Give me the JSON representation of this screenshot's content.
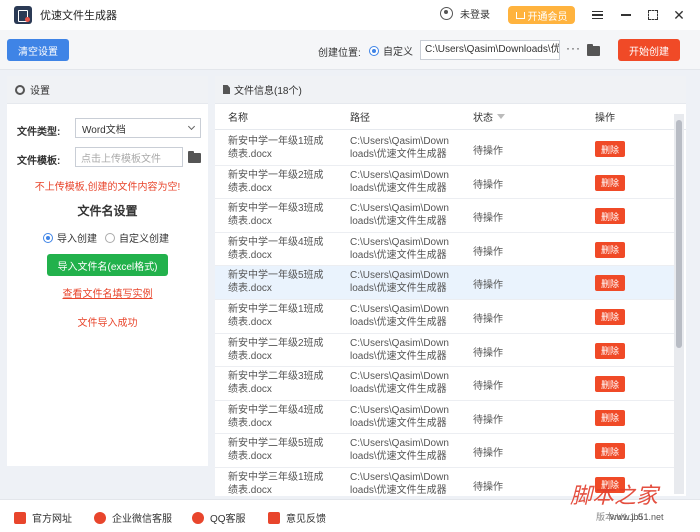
{
  "app": {
    "title": "优速文件生成器"
  },
  "header": {
    "login": "未登录",
    "vip": "开通会员"
  },
  "toolbar": {
    "clear_label": "清空设置",
    "location_label": "创建位置:",
    "location_mode": "自定义",
    "path_value": "C:\\Users\\Qasim\\Downloads\\优",
    "more": "···",
    "start_label": "开始创建"
  },
  "settings": {
    "title": "设置",
    "file_type_label": "文件类型:",
    "file_type_value": "Word文档",
    "template_label": "文件模板:",
    "template_placeholder": "点击上传模板文件",
    "warning": "不上传模板,创建的文件内容为空!",
    "filename_title": "文件名设置",
    "mode_import": "导入创建",
    "mode_custom": "自定义创建",
    "import_button": "导入文件名(excel格式)",
    "example_link": "查看文件名填写实例",
    "import_status": "文件导入成功"
  },
  "files": {
    "title": "文件信息(18个)",
    "columns": {
      "name": "名称",
      "path": "路径",
      "status": "状态",
      "op": "操作"
    },
    "delete_label": "删除",
    "rows": [
      {
        "name_1": "新安中学一年级1班成",
        "name_2": "绩表.docx",
        "path_1": "C:\\Users\\Qasim\\Down",
        "path_2": "loads\\优速文件生成器",
        "status": "待操作"
      },
      {
        "name_1": "新安中学一年级2班成",
        "name_2": "绩表.docx",
        "path_1": "C:\\Users\\Qasim\\Down",
        "path_2": "loads\\优速文件生成器",
        "status": "待操作"
      },
      {
        "name_1": "新安中学一年级3班成",
        "name_2": "绩表.docx",
        "path_1": "C:\\Users\\Qasim\\Down",
        "path_2": "loads\\优速文件生成器",
        "status": "待操作"
      },
      {
        "name_1": "新安中学一年级4班成",
        "name_2": "绩表.docx",
        "path_1": "C:\\Users\\Qasim\\Down",
        "path_2": "loads\\优速文件生成器",
        "status": "待操作"
      },
      {
        "name_1": "新安中学一年级5班成",
        "name_2": "绩表.docx",
        "path_1": "C:\\Users\\Qasim\\Down",
        "path_2": "loads\\优速文件生成器",
        "status": "待操作"
      },
      {
        "name_1": "新安中学二年级1班成",
        "name_2": "绩表.docx",
        "path_1": "C:\\Users\\Qasim\\Down",
        "path_2": "loads\\优速文件生成器",
        "status": "待操作"
      },
      {
        "name_1": "新安中学二年级2班成",
        "name_2": "绩表.docx",
        "path_1": "C:\\Users\\Qasim\\Down",
        "path_2": "loads\\优速文件生成器",
        "status": "待操作"
      },
      {
        "name_1": "新安中学二年级3班成",
        "name_2": "绩表.docx",
        "path_1": "C:\\Users\\Qasim\\Down",
        "path_2": "loads\\优速文件生成器",
        "status": "待操作"
      },
      {
        "name_1": "新安中学二年级4班成",
        "name_2": "绩表.docx",
        "path_1": "C:\\Users\\Qasim\\Down",
        "path_2": "loads\\优速文件生成器",
        "status": "待操作"
      },
      {
        "name_1": "新安中学二年级5班成",
        "name_2": "绩表.docx",
        "path_1": "C:\\Users\\Qasim\\Down",
        "path_2": "loads\\优速文件生成器",
        "status": "待操作"
      },
      {
        "name_1": "新安中学三年级1班成",
        "name_2": "绩表.docx",
        "path_1": "C:\\Users\\Qasim\\Down",
        "path_2": "loads\\优速文件生成器",
        "status": "待操作"
      }
    ]
  },
  "footer": {
    "website": "官方网址",
    "wechat": "企业微信客服",
    "qq": "QQ客服",
    "feedback": "意见反馈",
    "version": "版本:V1.1.0"
  },
  "watermark": {
    "text": "脚本之家",
    "url": "www.jb51.net"
  }
}
